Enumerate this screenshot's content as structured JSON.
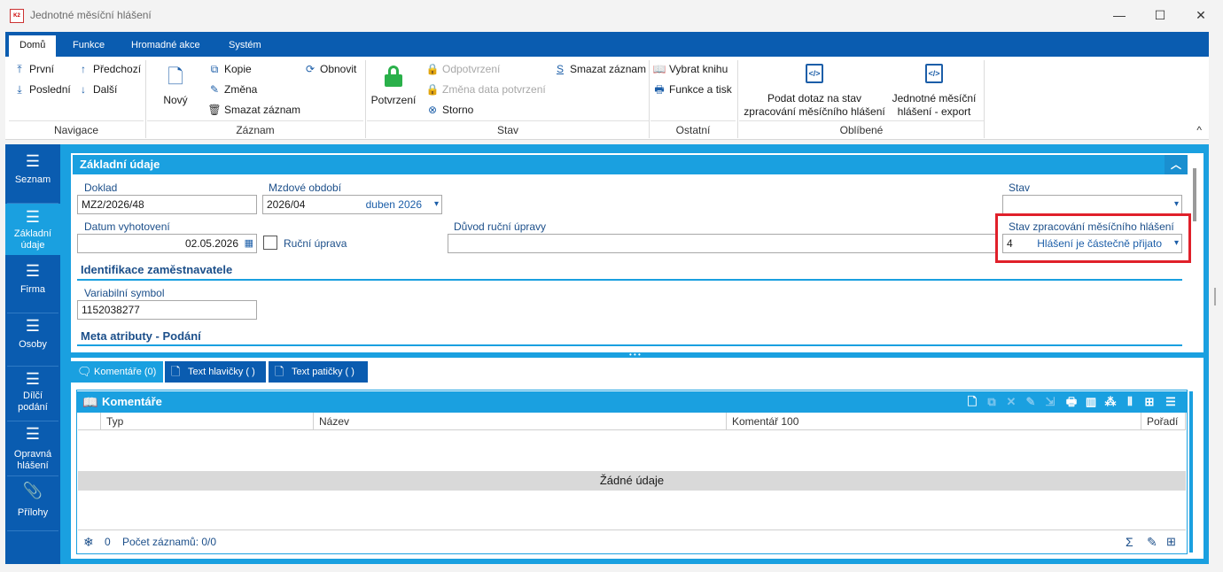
{
  "window": {
    "title": "Jednotné měsíční hlášení",
    "app_icon_text": "K2",
    "minimize": "—",
    "maximize": "☐",
    "close": "✕"
  },
  "ribbon": {
    "tabs": [
      "Domů",
      "Funkce",
      "Hromadné akce",
      "Systém"
    ],
    "groups": {
      "navigace": {
        "label": "Navigace",
        "items": [
          "První",
          "Předchozí",
          "Poslední",
          "Další"
        ]
      },
      "zaznam": {
        "label": "Záznam",
        "new": "Nový",
        "items": [
          "Kopie",
          "Obnovit",
          "Změna",
          "Smazat záznam"
        ]
      },
      "stav": {
        "label": "Stav",
        "confirm": "Potvrzení",
        "items": [
          "Odpotvrzení",
          "Změna data potvrzení",
          "Storno",
          "Smazat záznam"
        ]
      },
      "ostatni": {
        "label": "Ostatní",
        "items": [
          "Vybrat knihu",
          "Funkce a tisk"
        ]
      },
      "oblibene": {
        "label": "Oblíbené",
        "items": [
          "Podat dotaz na stav zpracování měsíčního hlášení",
          "Jednotné měsíční hlášení - export"
        ],
        "item1_line1": "Podat dotaz na stav",
        "item1_line2": "zpracování měsíčního hlášení",
        "item2_line1": "Jednotné měsíční",
        "item2_line2": "hlášení - export"
      }
    },
    "collapse": "^"
  },
  "sidebar": {
    "items": [
      {
        "label": "Seznam",
        "icon": "menu-icon"
      },
      {
        "label": "Základní údaje",
        "line1": "Základní",
        "line2": "údaje",
        "icon": "list-icon"
      },
      {
        "label": "Firma",
        "icon": "list-icon"
      },
      {
        "label": "Osoby",
        "icon": "menu-icon"
      },
      {
        "label": "Dílčí podání",
        "line1": "Dílčí",
        "line2": "podání",
        "icon": "menu-icon"
      },
      {
        "label": "Opravná hlášení",
        "line1": "Opravná",
        "line2": "hlášení",
        "icon": "menu-icon"
      },
      {
        "label": "Přílohy",
        "icon": "paperclip-icon"
      }
    ]
  },
  "form": {
    "section_title": "Základní údaje",
    "doklad": {
      "label": "Doklad",
      "value": "MZ2/2026/48"
    },
    "mzdove_obdobi": {
      "label": "Mzdové období",
      "value": "2026/04",
      "text": "duben 2026"
    },
    "stav": {
      "label": "Stav",
      "value": ""
    },
    "datum_vyhotoveni": {
      "label": "Datum vyhotovení",
      "value": "02.05.2026"
    },
    "rucni_uprava": {
      "label": "Ruční úprava",
      "checked": false
    },
    "duvod_rucni_upravy": {
      "label": "Důvod ruční úpravy",
      "value": ""
    },
    "stav_zpracovani": {
      "label": "Stav zpracování měsíčního hlášení",
      "code": "4",
      "text": "Hlášení je částečně přijato"
    },
    "identifikace_header": "Identifikace zaměstnavatele",
    "variabilni_symbol": {
      "label": "Variabilní symbol",
      "value": "1152038277"
    },
    "meta_header": "Meta atributy  - Podání"
  },
  "bottom_tabs": [
    "Komentáře (0)",
    "Text hlavičky ( )",
    "Text patičky ( )"
  ],
  "grid": {
    "title": "Komentáře",
    "columns": [
      "Typ",
      "Název",
      "Komentář 100",
      "Pořadí"
    ],
    "empty_text": "Žádné údaje",
    "footer_count": "0",
    "footer_records": "Počet záznamů: 0/0"
  },
  "colors": {
    "primary": "#0a5cb0",
    "accent": "#1aa0e0",
    "highlight": "#e0202a"
  }
}
